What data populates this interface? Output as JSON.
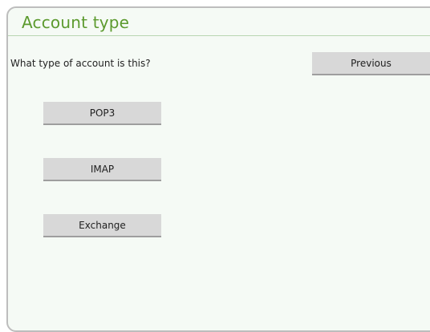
{
  "dialog": {
    "title": "Account type",
    "question": "What type of account is this?"
  },
  "buttons": {
    "previous": "Previous",
    "pop3": "POP3",
    "imap": "IMAP",
    "exchange": "Exchange"
  },
  "colors": {
    "title_green": "#5c9a2e",
    "panel_bg": "#f5faf5",
    "button_bg": "#d8d8d8"
  }
}
